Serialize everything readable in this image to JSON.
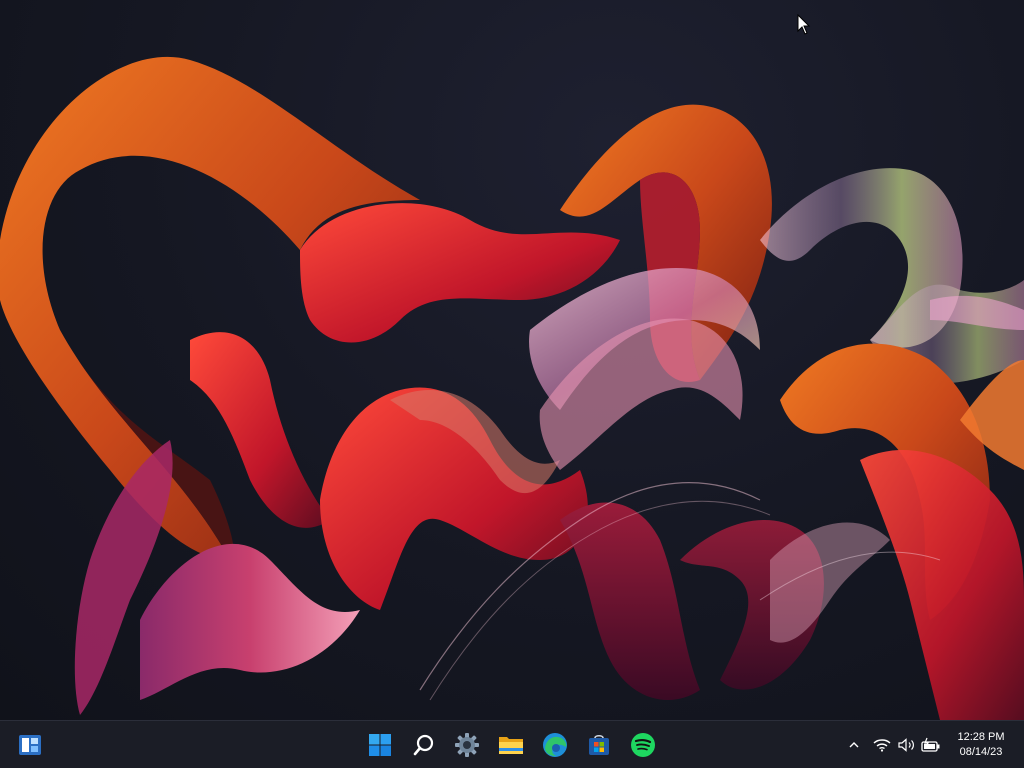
{
  "desktop": {
    "wallpaper": "windows-11-flow-ribbons",
    "colors": {
      "background": "#14161f",
      "ribbon_orange": "#e0641e",
      "ribbon_red": "#d2202a",
      "ribbon_magenta": "#b4306e",
      "ribbon_pink": "#e29ab8"
    }
  },
  "taskbar": {
    "left_widget": {
      "icon": "widgets-icon"
    },
    "pinned": [
      {
        "name": "start-button",
        "icon": "windows-logo-icon"
      },
      {
        "name": "search-button",
        "icon": "search-icon"
      },
      {
        "name": "settings-app",
        "icon": "gear-icon"
      },
      {
        "name": "file-explorer-app",
        "icon": "folder-icon"
      },
      {
        "name": "edge-app",
        "icon": "edge-icon"
      },
      {
        "name": "store-app",
        "icon": "store-icon"
      },
      {
        "name": "spotify-app",
        "icon": "spotify-icon"
      }
    ],
    "tray": {
      "icons": [
        "chevron-up-icon",
        "wifi-icon",
        "volume-icon",
        "battery-icon"
      ]
    },
    "clock": {
      "time": "12:28 PM",
      "date": "08/14/23"
    },
    "accent": "#60cdff"
  }
}
